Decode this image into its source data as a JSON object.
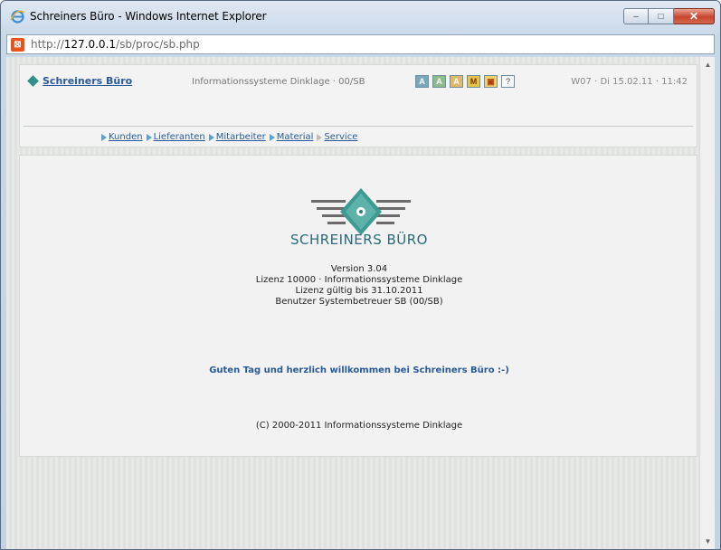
{
  "window": {
    "title": "Schreiners Büro - Windows Internet Explorer",
    "controls": {
      "minimize": "–",
      "maximize": "□",
      "close": "✕"
    }
  },
  "address": {
    "prefix": "http://",
    "host": "127.0.0.1",
    "path": "/sb/proc/sb.php"
  },
  "header": {
    "brand": "Schreiners Büro",
    "org": "Informationssysteme Dinklage · 00/SB",
    "toolbar_icons": [
      {
        "name": "icon-a",
        "glyph": "A"
      },
      {
        "name": "icon-b",
        "glyph": "A"
      },
      {
        "name": "icon-c",
        "glyph": "A"
      },
      {
        "name": "icon-m",
        "glyph": "M"
      },
      {
        "name": "icon-calendar",
        "glyph": "▣"
      },
      {
        "name": "help-icon",
        "glyph": "?"
      }
    ],
    "datetime": "W07 · Di 15.02.11 · 11:42"
  },
  "nav": {
    "items": [
      {
        "label": "Kunden",
        "active": true
      },
      {
        "label": "Lieferanten",
        "active": true
      },
      {
        "label": "Mitarbeiter",
        "active": true
      },
      {
        "label": "Material",
        "active": true
      },
      {
        "label": "Service",
        "active": false
      }
    ]
  },
  "main": {
    "logo_text": "SCHREINERS BÜRO",
    "version": "Version 3.04",
    "license": "Lizenz 10000 · Informationssysteme Dinklage",
    "valid_until": "Lizenz gültig bis 31.10.2011",
    "user": "Benutzer Systembetreuer SB (00/SB)",
    "welcome": "Guten Tag und herzlich willkommen bei Schreiners Büro :-)",
    "copyright": "(C) 2000-2011 Informationssysteme Dinklage"
  },
  "colors": {
    "brand_teal": "#2f8f8a",
    "link_blue": "#2a5a9a",
    "close_red": "#c8452d"
  }
}
